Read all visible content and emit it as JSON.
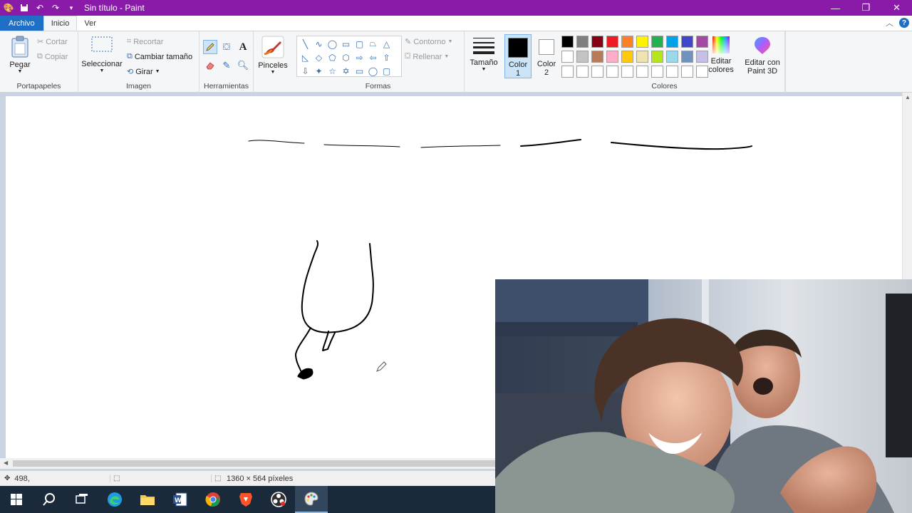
{
  "window": {
    "title": "Sin título - Paint"
  },
  "menu": {
    "file": "Archivo",
    "home": "Inicio",
    "view": "Ver"
  },
  "clipboard": {
    "paste": "Pegar",
    "cut": "Cortar",
    "copy": "Copiar",
    "label": "Portapapeles"
  },
  "image": {
    "select": "Seleccionar",
    "crop": "Recortar",
    "resize": "Cambiar tamaño",
    "rotate": "Girar",
    "label": "Imagen"
  },
  "tools": {
    "label": "Herramientas",
    "items": [
      "pencil-icon",
      "fill-icon",
      "text-icon",
      "eraser-icon",
      "color-picker-icon",
      "magnifier-icon"
    ]
  },
  "brushes": {
    "label": "Pinceles"
  },
  "shapes": {
    "outline": "Contorno",
    "fill": "Rellenar",
    "label": "Formas",
    "items": [
      "╲",
      "∿",
      "◯",
      "▭",
      "▢",
      "⏢",
      "△",
      "◺",
      "◇",
      "⬠",
      "⬡",
      "⇨",
      "⇦",
      "⇧",
      "⇩",
      "✦",
      "☆",
      "✡",
      "▭",
      "◯",
      "▢"
    ]
  },
  "size": {
    "label": "Tamaño"
  },
  "colors": {
    "color1": "Color",
    "color1_num": "1",
    "color2": "Color",
    "color2_num": "2",
    "edit": "Editar colores",
    "paint3d": "Editar con Paint 3D",
    "label": "Colores",
    "color1_value": "#000000",
    "color2_value": "#ffffff",
    "palette_row1": [
      "#000000",
      "#7f7f7f",
      "#880015",
      "#ed1c24",
      "#ff7f27",
      "#fff200",
      "#22b14c",
      "#00a2e8",
      "#3f48cc",
      "#a349a4"
    ],
    "palette_row2": [
      "#ffffff",
      "#c3c3c3",
      "#b97a57",
      "#ffaec9",
      "#ffc90e",
      "#efe4b0",
      "#b5e61d",
      "#99d9ea",
      "#7092be",
      "#c8bfe7"
    ],
    "palette_row3": [
      "#ffffff",
      "#ffffff",
      "#ffffff",
      "#ffffff",
      "#ffffff",
      "#ffffff",
      "#ffffff",
      "#ffffff",
      "#ffffff",
      "#ffffff"
    ]
  },
  "status": {
    "cursor": "498,",
    "dimensions": "1360 × 564 píxeles"
  }
}
